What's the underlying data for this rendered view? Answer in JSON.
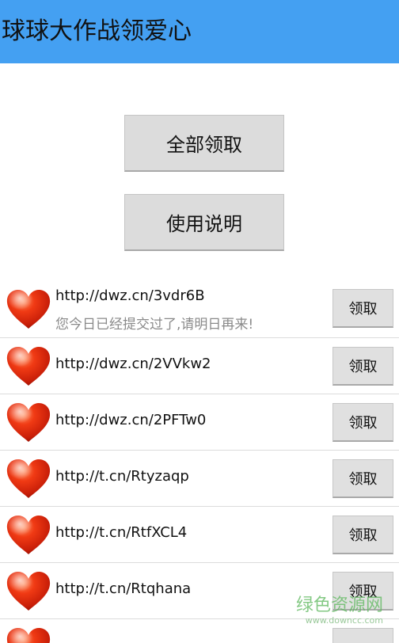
{
  "header": {
    "title": "球球大作战领爱心",
    "bg_color": "#44a0f2"
  },
  "actions": {
    "claim_all_label": "全部领取",
    "instructions_label": "使用说明"
  },
  "list": {
    "items": [
      {
        "link": "http://dwz.cn/3vdr6B",
        "status": "您今日已经提交过了,请明日再来!",
        "button": "领取"
      },
      {
        "link": "http://dwz.cn/2VVkw2",
        "button": "领取"
      },
      {
        "link": "http://dwz.cn/2PFTw0",
        "button": "领取"
      },
      {
        "link": "http://t.cn/Rtyzaqp",
        "button": "领取"
      },
      {
        "link": "http://t.cn/RtfXCL4",
        "button": "领取"
      },
      {
        "link": "http://t.cn/Rtqhana",
        "button": "领取"
      }
    ],
    "icon": "red-heart-icon",
    "heart_color": "#d42a10"
  },
  "watermark": {
    "text": "绿色资源网",
    "url": "www.downcc.com"
  }
}
